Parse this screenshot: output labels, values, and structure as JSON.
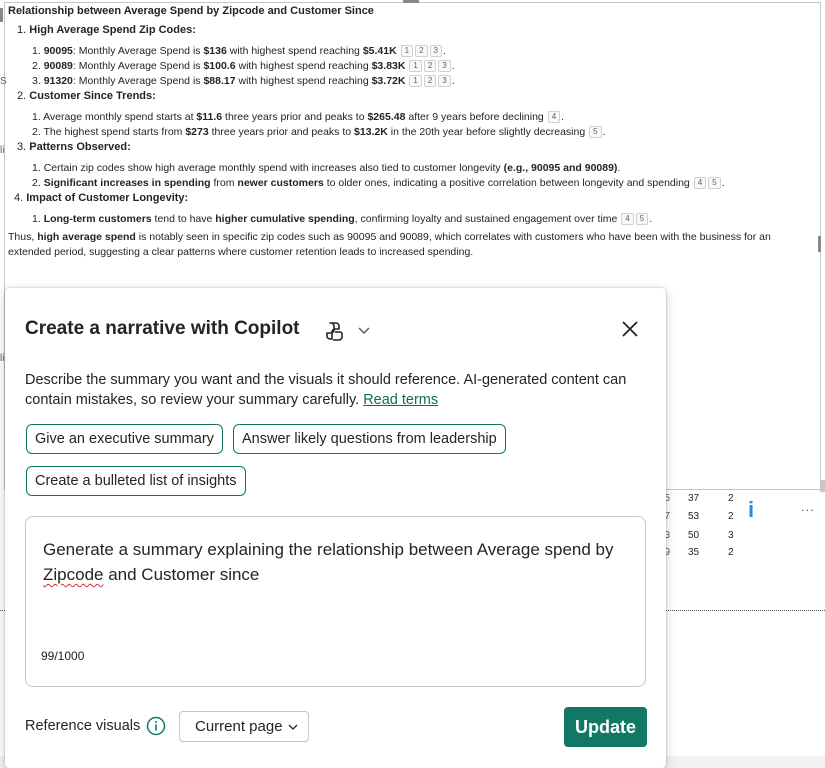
{
  "report": {
    "title": "Relationship between Average Spend by Zipcode and Customer Since",
    "sections": [
      {
        "number": "1.",
        "heading": "High Average Spend Zip Codes:",
        "items": [
          {
            "num": "1.",
            "zip": "90095",
            "pre": ": Monthly Average Spend is ",
            "spend": "$136",
            "mid": " with highest spend reaching ",
            "peak": "$5.41K",
            "cites": [
              "1",
              "2",
              "3"
            ]
          },
          {
            "num": "2.",
            "zip": "90089",
            "pre": ": Monthly Average Spend is ",
            "spend": "$100.6",
            "mid": " with highest spend reaching ",
            "peak": "$3.83K",
            "cites": [
              "1",
              "2",
              "3"
            ]
          },
          {
            "num": "3.",
            "zip": "91320",
            "pre": ": Monthly Average Spend is ",
            "spend": "$88.17",
            "mid": " with highest spend reaching ",
            "peak": "$3.72K",
            "cites": [
              "1",
              "2",
              "3"
            ]
          }
        ]
      },
      {
        "number": "2.",
        "heading": "Customer Since Trends:",
        "items": [
          {
            "num": "1.",
            "t1": "Average monthly spend starts at ",
            "b1": "$11.6",
            "t2": " three years prior and peaks to ",
            "b2": "$265.48",
            "t3": " after 9 years before declining",
            "cites": [
              "4"
            ]
          },
          {
            "num": "2.",
            "t1": "The highest spend starts from ",
            "b1": "$273",
            "t2": " three years prior and peaks to ",
            "b2": "$13.2K",
            "t3": " in the 20th year before slightly decreasing",
            "cites": [
              "5"
            ]
          }
        ]
      },
      {
        "number": "3.",
        "heading": "Patterns Observed:",
        "items": [
          {
            "num": "1.",
            "t1": "Certain zip codes show high average monthly spend with increases also tied to customer longevity ",
            "b1": "(e.g., 90095 and 90089)",
            "t2": "."
          },
          {
            "num": "2.",
            "b0": "Significant increases in spending",
            "t1": " from ",
            "b1": "newer customers",
            "t2": " to older ones, indicating a positive correlation between longevity and spending",
            "cites": [
              "4",
              "5"
            ]
          }
        ]
      },
      {
        "number": "4.",
        "heading": "Impact of Customer Longevity:",
        "items": [
          {
            "num": "1.",
            "b0": "Long-term customers",
            "t1": " tend to have ",
            "b1": "higher cumulative spending",
            "t2": ", confirming loyalty and sustained engagement over time",
            "cites": [
              "4",
              "5"
            ]
          }
        ]
      }
    ],
    "conclusion": {
      "t0": "Thus, ",
      "b0": "high average spend",
      "t1": " is notably seen in specific zip codes such as 90095 and 90089, which correlates with customers who have been with the business for an extended period, suggesting a clear patterns where customer retention leads to increased spending."
    },
    "dot": "."
  },
  "background_table": {
    "rows": [
      {
        "c1": "5",
        "c2": "37",
        "c3": "2"
      },
      {
        "c1": "7",
        "c2": "53",
        "c3": "2"
      },
      {
        "c1": "3",
        "c2": "50",
        "c3": "3"
      },
      {
        "c1": "9",
        "c2": "35",
        "c3": "2"
      }
    ],
    "more_label": "..."
  },
  "left_fragments": [
    "S",
    "S",
    "S",
    "li",
    "li"
  ],
  "dialog": {
    "title": "Create a narrative with Copilot",
    "description": "Describe the summary you want and the visuals it should reference. AI-generated content can contain mistakes, so review your summary carefully.",
    "read_terms": "Read terms",
    "chips": [
      "Give an executive summary",
      "Answer likely questions from leadership",
      "Create a bulleted list of insights"
    ],
    "prompt_before": "Generate a summary explaining the relationship between Average spend by ",
    "prompt_misspelled": "Zipcode",
    "prompt_after": " and Customer since",
    "char_count": "99/1000",
    "reference_label": "Reference visuals",
    "reference_value": "Current page",
    "update_label": "Update"
  },
  "colors": {
    "accent": "#117865",
    "link": "#0f6c5c",
    "info_blue": "#2b88d8",
    "spell_error": "#d13438"
  },
  "icons": [
    "copilot-icon",
    "chevron-down-icon",
    "close-icon",
    "info-icon",
    "more-options-icon"
  ]
}
